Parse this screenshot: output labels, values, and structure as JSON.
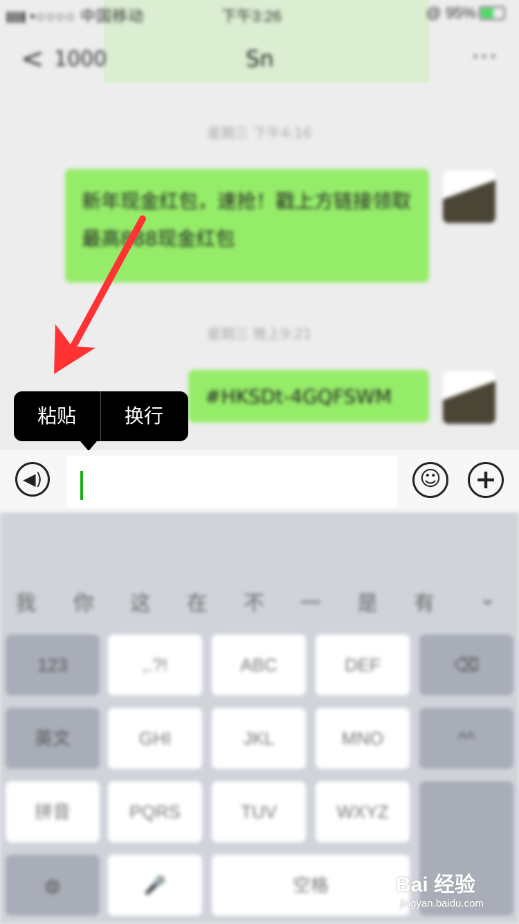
{
  "status_bar": {
    "carrier": "•○○○○ 中国移动",
    "time": "下午3:26",
    "battery": "@ 95%"
  },
  "nav": {
    "back_glyph": "<",
    "back_count": "1000",
    "title": "Sn",
    "more_glyph": "···"
  },
  "messages": [
    {
      "type": "time",
      "text": "星期三 下午4:16"
    },
    {
      "type": "bubble",
      "text": "新年现金红包，速抢！戳上方链接领取最高888现金红包"
    },
    {
      "type": "time",
      "text": "星期三 晚上9:21"
    },
    {
      "type": "bubble",
      "text": "#HKSDt-4GQFSWM"
    }
  ],
  "popup": {
    "paste": "粘贴",
    "newline": "换行"
  },
  "toolbar": {
    "voice_glyph": "◀)",
    "emoji_glyph": "☺",
    "plus_glyph": "+"
  },
  "keyboard": {
    "candidates": [
      "我",
      "你",
      "这",
      "在",
      "不",
      "一",
      "是",
      "有",
      "⌄"
    ],
    "keys": {
      "k123": "123",
      "punct": ",.?!",
      "abc": "ABC",
      "def": "DEF",
      "del": "⌫",
      "en": "英文",
      "ghi": "GHI",
      "jkl": "JKL",
      "mno": "MNO",
      "retype": "^^",
      "pinyin": "拼音",
      "pqrs": "PQRS",
      "tuv": "TUV",
      "wxyz": "WXYZ",
      "globe": "◍",
      "mic": "🎤",
      "space": "空格"
    }
  },
  "watermark": {
    "text": "Bai 经验",
    "url": "jingyan.baidu.com"
  },
  "colors": {
    "bubble": "#95ec69",
    "cursor": "#1aad19",
    "popup_bg": "#000000",
    "arrow": "#ff3333"
  }
}
